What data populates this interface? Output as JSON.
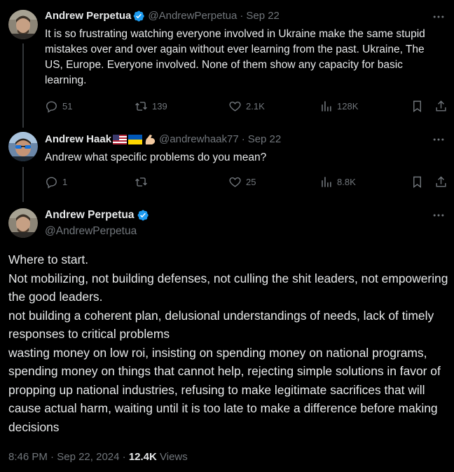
{
  "colors": {
    "background": "#000000",
    "text": "#e7e9ea",
    "muted": "#71767b",
    "verified": "#1d9bf0",
    "thread_line": "#333639"
  },
  "tweets": [
    {
      "name": "Andrew Perpetua",
      "handle": "@AndrewPerpetua",
      "separator": "·",
      "date": "Sep 22",
      "verified": true,
      "text": "It is so frustrating watching everyone involved in Ukraine make the same stupid mistakes over and over again without ever learning from the past. Ukraine, The US, Europe. Everyone involved. None of them show any capacity for basic learning.",
      "stats": {
        "replies": "51",
        "reposts": "139",
        "likes": "2.1K",
        "views": "128K"
      }
    },
    {
      "name": "Andrew Haak",
      "name_emoji": [
        "us-flag-icon",
        "ukraine-flag-icon",
        "flexed-biceps-icon"
      ],
      "handle": "@andrewhaak77",
      "separator": "·",
      "date": "Sep 22",
      "verified": false,
      "text": "Andrew what specific problems do you mean?",
      "stats": {
        "replies": "1",
        "reposts": "",
        "likes": "25",
        "views": "8.8K"
      }
    }
  ],
  "main_tweet": {
    "name": "Andrew Perpetua",
    "handle": "@AndrewPerpetua",
    "verified": true,
    "lines": [
      "Where to start.",
      "Not mobilizing, not building defenses, not culling the shit leaders, not empowering the good leaders.",
      "not building a coherent plan, delusional understandings of needs, lack of timely responses to critical problems",
      "wasting money on low roi, insisting on spending money on national programs, spending money on things that cannot help, rejecting simple solutions in favor of propping up national industries, refusing to make legitimate sacrifices that will cause actual harm, waiting until it is too late to make a difference before making decisions"
    ],
    "time": "8:46 PM",
    "separator": "·",
    "date": "Sep 22, 2024",
    "separator2": "·",
    "views_count": "12.4K",
    "views_label": "Views"
  },
  "icons": [
    "reply-icon",
    "repost-icon",
    "like-icon",
    "views-icon",
    "bookmark-icon",
    "share-icon",
    "more-icon",
    "verified-icon"
  ]
}
